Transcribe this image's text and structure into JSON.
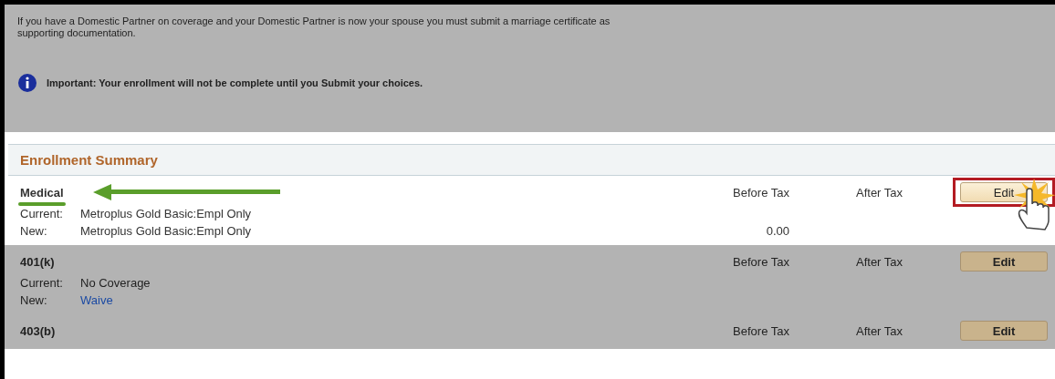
{
  "notice": {
    "dimmed": true,
    "text": "If you have a Domestic Partner on coverage and your Domestic Partner is now your spouse you must submit a marriage certificate as supporting documentation.",
    "important": "Important: Your enrollment will not be complete until you Submit your choices."
  },
  "enrollment_summary": {
    "title": "Enrollment Summary"
  },
  "plans": [
    {
      "name": "Medical",
      "highlighted": true,
      "callout": true,
      "before_tax_label": "Before Tax",
      "after_tax_label": "After Tax",
      "button": "Edit",
      "current_label": "Current:",
      "current": "Metroplus Gold Basic:Empl Only",
      "new_label": "New:",
      "new": "Metroplus Gold Basic:Empl Only",
      "new_link": false,
      "new_before_tax": "0.00"
    },
    {
      "name": "401(k)",
      "highlighted": false,
      "callout": false,
      "before_tax_label": "Before Tax",
      "after_tax_label": "After Tax",
      "button": "Edit",
      "current_label": "Current:",
      "current": "No Coverage",
      "new_label": "New:",
      "new": "Waive",
      "new_link": true
    },
    {
      "name": "403(b)",
      "highlighted": false,
      "callout": false,
      "before_tax_label": "Before Tax",
      "after_tax_label": "After Tax",
      "button": "Edit"
    }
  ]
}
